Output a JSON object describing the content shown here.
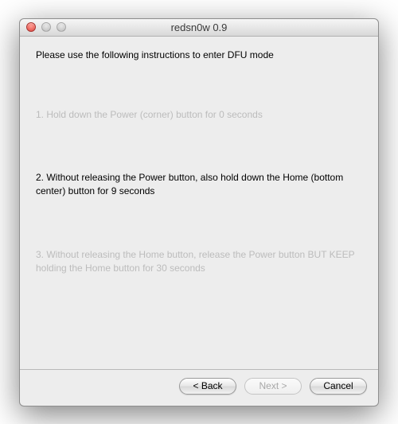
{
  "window": {
    "title": "redsn0w 0.9"
  },
  "heading": "Please use the following instructions to enter DFU mode",
  "steps": [
    {
      "text": "1. Hold down the Power (corner) button for 0 seconds",
      "active": false
    },
    {
      "text": "2. Without releasing the Power button, also hold down the Home (bottom center) button for 9 seconds",
      "active": true
    },
    {
      "text": "3. Without releasing the Home button, release the Power button BUT KEEP holding the Home button for 30 seconds",
      "active": false
    }
  ],
  "buttons": {
    "back": {
      "label": "< Back",
      "enabled": true
    },
    "next": {
      "label": "Next >",
      "enabled": false
    },
    "cancel": {
      "label": "Cancel",
      "enabled": true
    }
  }
}
